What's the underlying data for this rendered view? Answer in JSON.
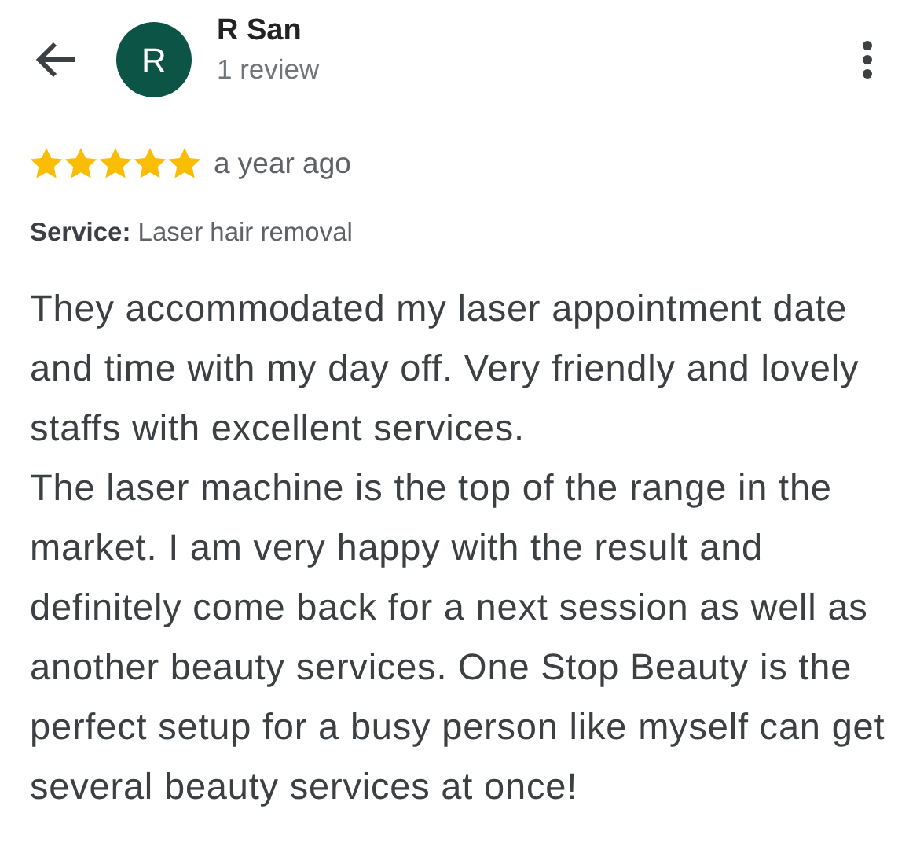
{
  "reviewer": {
    "initial": "R",
    "name": "R San",
    "review_count": "1 review"
  },
  "rating": {
    "stars": 5,
    "time": "a year ago"
  },
  "service": {
    "label": "Service:",
    "value": "Laser hair removal"
  },
  "paragraphs": [
    "They accommodated my laser appointment date and time with my day off. Very friendly and lovely staffs with excellent services.",
    "The laser machine is the top of the range in the market. I am very happy with the result and definitely come back for a next session as well as another beauty services. One Stop Beauty is the perfect setup for a busy person like myself can get several beauty services at once!"
  ]
}
